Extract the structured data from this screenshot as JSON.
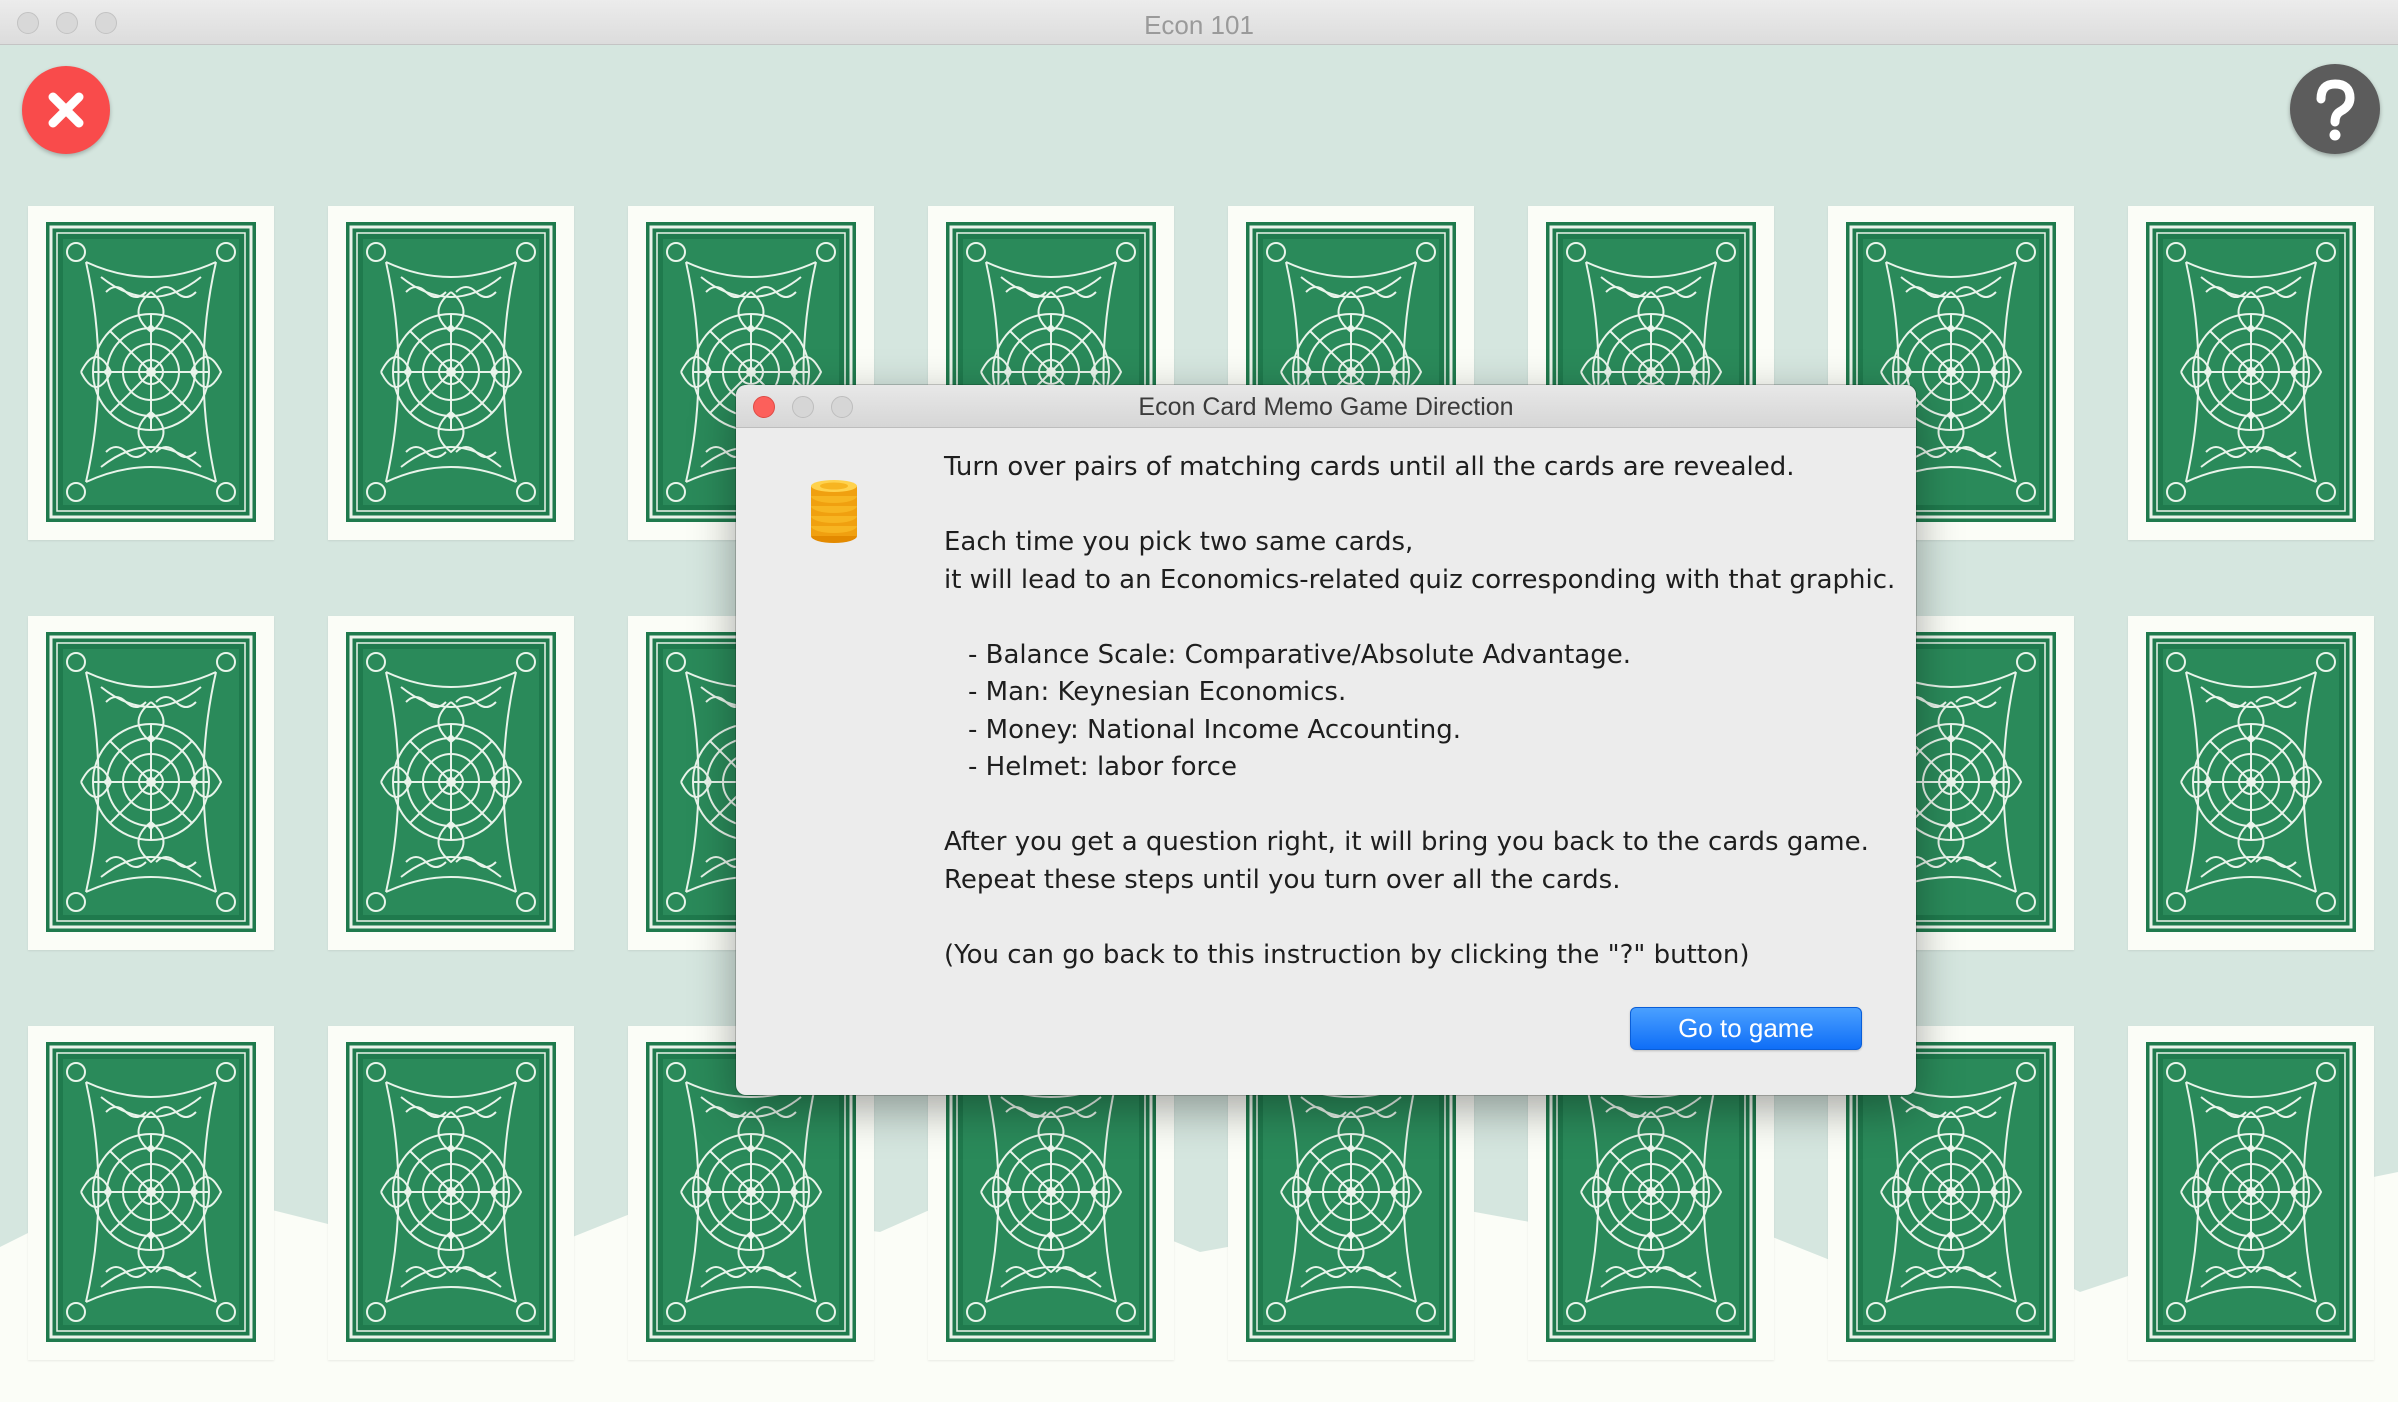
{
  "window": {
    "title": "Econ 101"
  },
  "toolbar": {
    "close_icon": "close-x-icon",
    "help_icon": "question-mark-icon",
    "close_color": "#f94b4b",
    "help_color": "#5c5c5c"
  },
  "board": {
    "rows": 3,
    "columns": 8,
    "card_back": "green-ornate-card-back",
    "card_color": "#1f7a4d"
  },
  "dialog": {
    "title": "Econ Card Memo Game Direction",
    "icon": "coin-stack-icon",
    "intro": "Turn over pairs of matching cards until all the cards are revealed.",
    "pick_line1": "Each time you pick two same cards,",
    "pick_line2": "it will lead to an Economics-related quiz corresponding with that graphic.",
    "topics": [
      "- Balance Scale: Comparative/Absolute Advantage.",
      "- Man: Keynesian Economics.",
      "- Money: National Income Accounting.",
      "- Helmet: labor force"
    ],
    "after_line1": "After you get a question right, it will bring you back to the cards game.",
    "after_line2": "Repeat these steps until you turn over all the cards.",
    "note": "(You can go back to this instruction by clicking the \"?\" button)",
    "button_label": "Go to game",
    "button_color": "#1a78f5"
  }
}
